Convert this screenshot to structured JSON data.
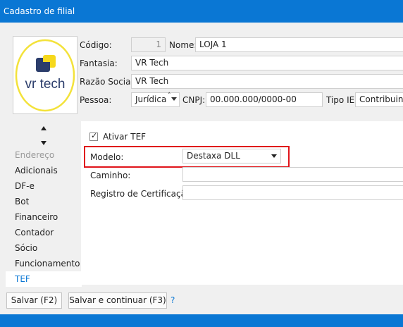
{
  "window": {
    "title": "Cadastro de filial"
  },
  "logo": {
    "text": "vr tech"
  },
  "fields": {
    "codigo": {
      "label": "Código:",
      "value": "1"
    },
    "nome": {
      "label": "Nome:",
      "value": "LOJA 1"
    },
    "fantasia": {
      "label": "Fantasia:",
      "value": "VR Tech"
    },
    "razao_social": {
      "label": "Razão Social:",
      "value": "VR Tech"
    },
    "pessoa": {
      "label": "Pessoa:",
      "value": "Jurídica"
    },
    "cnpj": {
      "label": "CNPJ:",
      "value": "00.000.000/0000-00"
    },
    "tipo_ie": {
      "label": "Tipo IE:",
      "value": "Contribuinte"
    }
  },
  "nav": {
    "items": [
      "Endereço",
      "Adicionais",
      "DF-e",
      "Bot",
      "Financeiro",
      "Contador",
      "Sócio",
      "Funcionamento",
      "TEF"
    ],
    "selected": "TEF"
  },
  "tef": {
    "ativar_label": "Ativar TEF",
    "ativar_checked": true,
    "modelo_label": "Modelo:",
    "modelo_value": "Destaxa DLL",
    "caminho_label": "Caminho:",
    "caminho_value": "",
    "registro_label": "Registro de Certificação:",
    "registro_value": ""
  },
  "buttons": {
    "save": "Salvar (F2)",
    "save_continue": "Salvar e continuar (F3)",
    "help": "?"
  },
  "colors": {
    "accent": "#0a77d4",
    "highlight": "#e0141a"
  }
}
